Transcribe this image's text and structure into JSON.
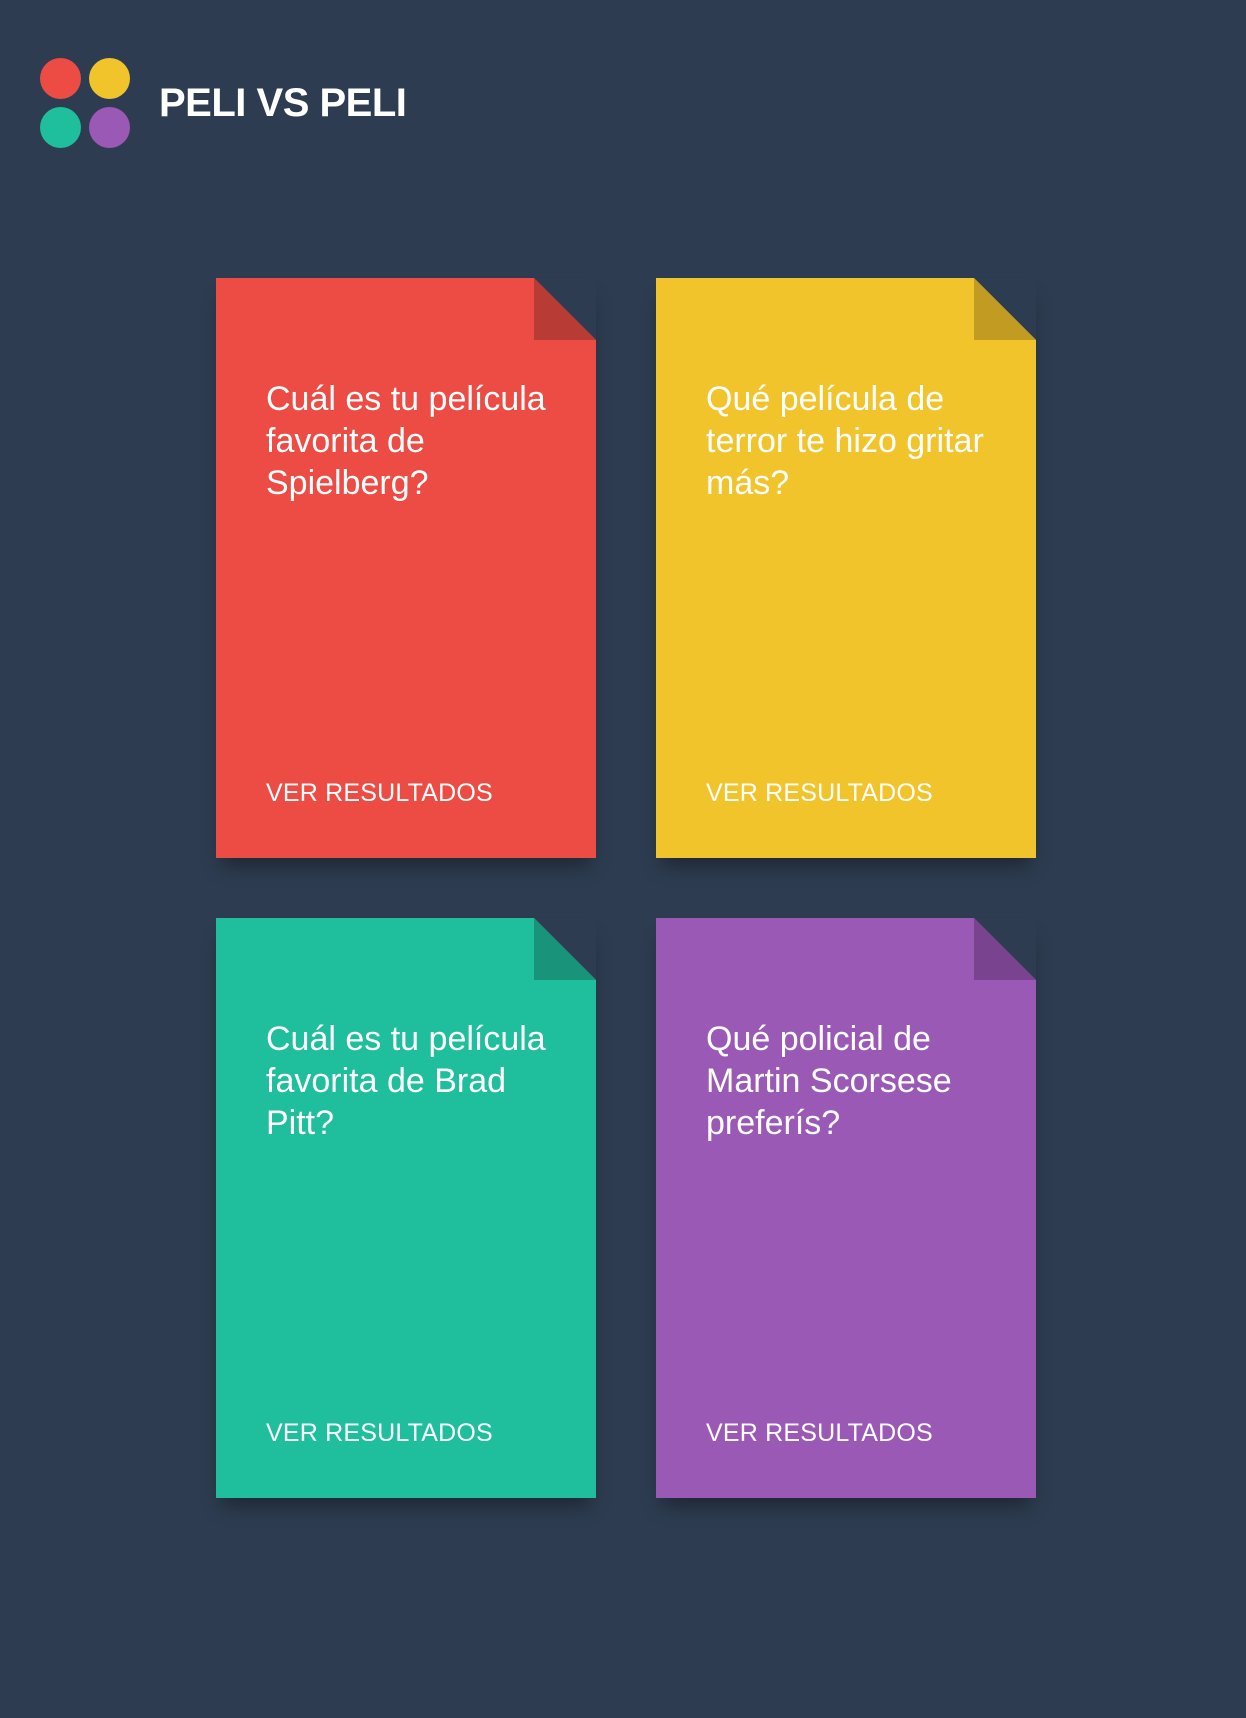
{
  "app": {
    "title": "PELI VS PELI",
    "logo_colors": [
      "#ec4c44",
      "#f1c42c",
      "#1fbe9c",
      "#9b59b6"
    ]
  },
  "cards": [
    {
      "question": "Cuál es tu película favorita de Spielberg?",
      "action_label": "VER RESULTADOS",
      "color": "#ec4c44",
      "fold_color": "#b83b35"
    },
    {
      "question": "Qué película de terror te hizo gritar más?",
      "action_label": "VER RESULTADOS",
      "color": "#f1c42c",
      "fold_color": "#c29c22"
    },
    {
      "question": "Cuál es tu película favorita de Brad Pitt?",
      "action_label": "VER RESULTADOS",
      "color": "#1fbe9c",
      "fold_color": "#19937a"
    },
    {
      "question": "Qué policial de Martin Scorsese preferís?",
      "action_label": "VER RESULTADOS",
      "color": "#9b59b6",
      "fold_color": "#79438f"
    }
  ]
}
